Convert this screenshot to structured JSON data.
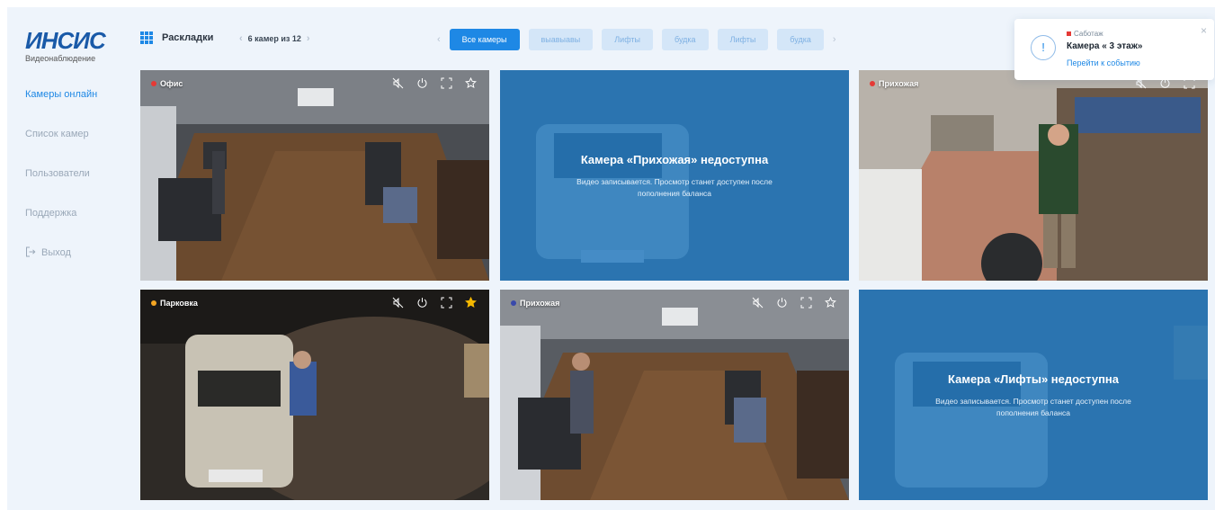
{
  "brand": {
    "logo": "ИНСИС",
    "subtitle": "Видеонаблюдение"
  },
  "sidebar": {
    "items": [
      {
        "label": "Камеры онлайн",
        "active": true
      },
      {
        "label": "Список камер"
      },
      {
        "label": "Пользователи"
      },
      {
        "label": "Поддержка"
      },
      {
        "label": "Выход",
        "icon": "logout-icon"
      }
    ]
  },
  "topbar": {
    "layouts_label": "Раскладки",
    "pager_text": "6 камер из 12",
    "filters": [
      "Все камеры",
      "выавыавы",
      "Лифты",
      "будка",
      "Лифты",
      "будка"
    ],
    "active_filter": "Все камеры"
  },
  "notification": {
    "source": "Саботаж",
    "title": "Камера « 3 этаж»",
    "link": "Перейти к событию"
  },
  "cameras": [
    {
      "name": "Офис",
      "dot_color": "#e53935",
      "status": "online"
    },
    {
      "title": "Камера «Прихожая» недоступна",
      "text": "Видео записывается. Просмотр станет доступен после пополнения баланса",
      "status": "unavailable"
    },
    {
      "name": "Прихожая",
      "dot_color": "#e53935",
      "status": "online"
    },
    {
      "name": "Парковка",
      "dot_color": "#f5a623",
      "status": "online",
      "favorite": true
    },
    {
      "name": "Прихожая",
      "dot_color": "#3949ab",
      "status": "online"
    },
    {
      "title": "Камера «Лифты» недоступна",
      "text": "Видео записывается. Просмотр станет доступен после пополнения баланса",
      "status": "unavailable"
    }
  ],
  "colors": {
    "accent": "#1e88e5",
    "background": "#eef4fb",
    "favorite": "#f5b800"
  }
}
